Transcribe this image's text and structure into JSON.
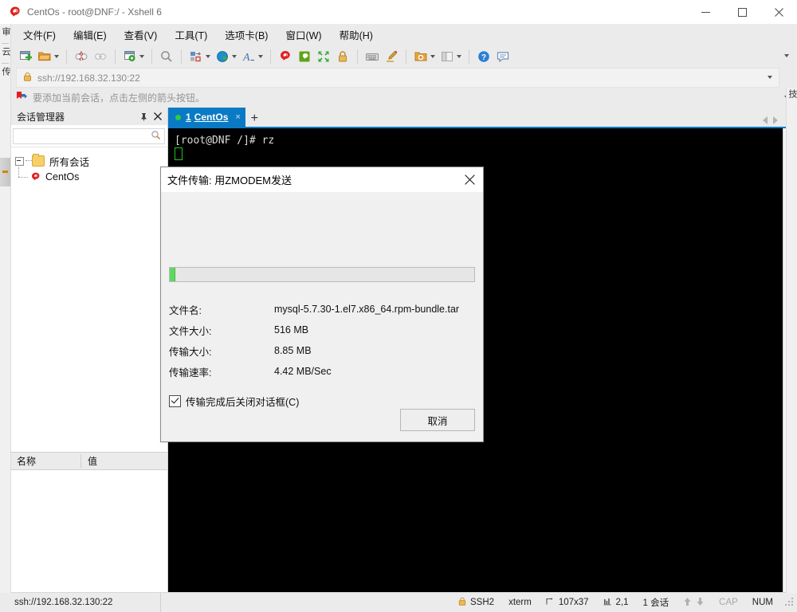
{
  "window": {
    "title": "CentOs - root@DNF:/ - Xshell 6",
    "app_icon": "xshell-logo-icon",
    "minimize_label": "—",
    "maximize_label": "□",
    "close_label": "✕"
  },
  "menubar": {
    "items": [
      {
        "label": "文件(F)",
        "name": "menu-file"
      },
      {
        "label": "编辑(E)",
        "name": "menu-edit"
      },
      {
        "label": "查看(V)",
        "name": "menu-view"
      },
      {
        "label": "工具(T)",
        "name": "menu-tools"
      },
      {
        "label": "选项卡(B)",
        "name": "menu-tabs"
      },
      {
        "label": "窗口(W)",
        "name": "menu-window"
      },
      {
        "label": "帮助(H)",
        "name": "menu-help"
      }
    ]
  },
  "toolbar": {
    "overflow_label": "▾",
    "items": [
      {
        "name": "new-session-icon",
        "has_caret": false
      },
      {
        "name": "open-folder-icon",
        "has_caret": true
      },
      {
        "name": "disconnect-icon",
        "has_caret": false
      },
      {
        "name": "reconnect-icon",
        "has_caret": false
      },
      {
        "name": "session-properties-icon",
        "has_caret": true
      },
      {
        "name": "find-icon",
        "has_caret": false
      },
      {
        "name": "layout-icon",
        "has_caret": true
      },
      {
        "name": "globe-encoding-icon",
        "has_caret": true
      },
      {
        "name": "font-icon",
        "has_caret": true
      },
      {
        "name": "xshell-icon",
        "has_caret": false
      },
      {
        "name": "xftp-icon",
        "has_caret": false
      },
      {
        "name": "fullscreen-icon",
        "has_caret": false
      },
      {
        "name": "lock-icon",
        "has_caret": false
      },
      {
        "name": "keyboard-icon",
        "has_caret": false
      },
      {
        "name": "highlight-icon",
        "has_caret": false
      },
      {
        "name": "add-to-folder-icon",
        "has_caret": true
      },
      {
        "name": "split-view-icon",
        "has_caret": true
      },
      {
        "name": "help-icon",
        "has_caret": false
      },
      {
        "name": "feedback-icon",
        "has_caret": false
      }
    ]
  },
  "address_bar": {
    "lock_icon": "lock-icon",
    "value": "ssh://192.168.32.130:22",
    "placeholder": "ssh://",
    "dropdown_label": "▾"
  },
  "quick_bar": {
    "icon": "bookmark-arrow-icon",
    "text": "要添加当前会话，点击左侧的箭头按钮。",
    "dropdown_label": "▾"
  },
  "left_strip": {
    "labels": [
      "审",
      "云",
      "传"
    ]
  },
  "right_strip": {
    "labels": [
      "技"
    ]
  },
  "session_manager": {
    "title": "会话管理器",
    "pin_label": "⚐",
    "close_label": "✕",
    "search": {
      "value": "",
      "placeholder": "",
      "icon": "search-icon"
    },
    "tree": {
      "root": {
        "label": "所有会话",
        "icon": "folder-icon"
      },
      "children": [
        {
          "label": "CentOs",
          "icon": "xshell-session-icon"
        }
      ]
    },
    "properties": {
      "columns": [
        "名称",
        "值"
      ],
      "rows": []
    }
  },
  "tabs": {
    "items": [
      {
        "index": "1",
        "label": "CentOs",
        "status": "connected",
        "close_label": "×"
      }
    ],
    "new_tab_label": "+",
    "prev_label": "◀",
    "next_label": "▶",
    "list_label": "▾"
  },
  "terminal": {
    "prompt_line": "[root@DNF /]# rz",
    "cursor": "block-cursor",
    "scroll_up_label": "∧",
    "scroll_down_label": "∨"
  },
  "dialog": {
    "title": "文件传输: 用ZMODEM发送",
    "close_label": "✕",
    "progress_percent": 1.7,
    "rows": [
      {
        "label": "文件名:",
        "value": "mysql-5.7.30-1.el7.x86_64.rpm-bundle.tar"
      },
      {
        "label": "文件大小:",
        "value": "516 MB"
      },
      {
        "label": "传输大小:",
        "value": "8.85 MB"
      },
      {
        "label": "传输速率:",
        "value": "4.42 MB/Sec"
      }
    ],
    "checkbox": {
      "label": "传输完成后关闭对话框(C)",
      "checked": true
    },
    "cancel_button": "取消"
  },
  "statusbar": {
    "url": "ssh://192.168.32.130:22",
    "protocol": "SSH2",
    "term_type": "xterm",
    "size": "107x37",
    "cursor_pos": "2,1",
    "sessions": "1 会话",
    "cap": "CAP",
    "num": "NUM",
    "lock_icon": "lock-icon",
    "up_icon": "arrow-up-icon",
    "down_icon": "arrow-down-icon"
  },
  "colors": {
    "accent": "#0a7ac4",
    "chrome": "#ebebeb",
    "terminal_bg": "#000000",
    "progress_green": "#5fd862",
    "status_green": "#2ecc40"
  }
}
